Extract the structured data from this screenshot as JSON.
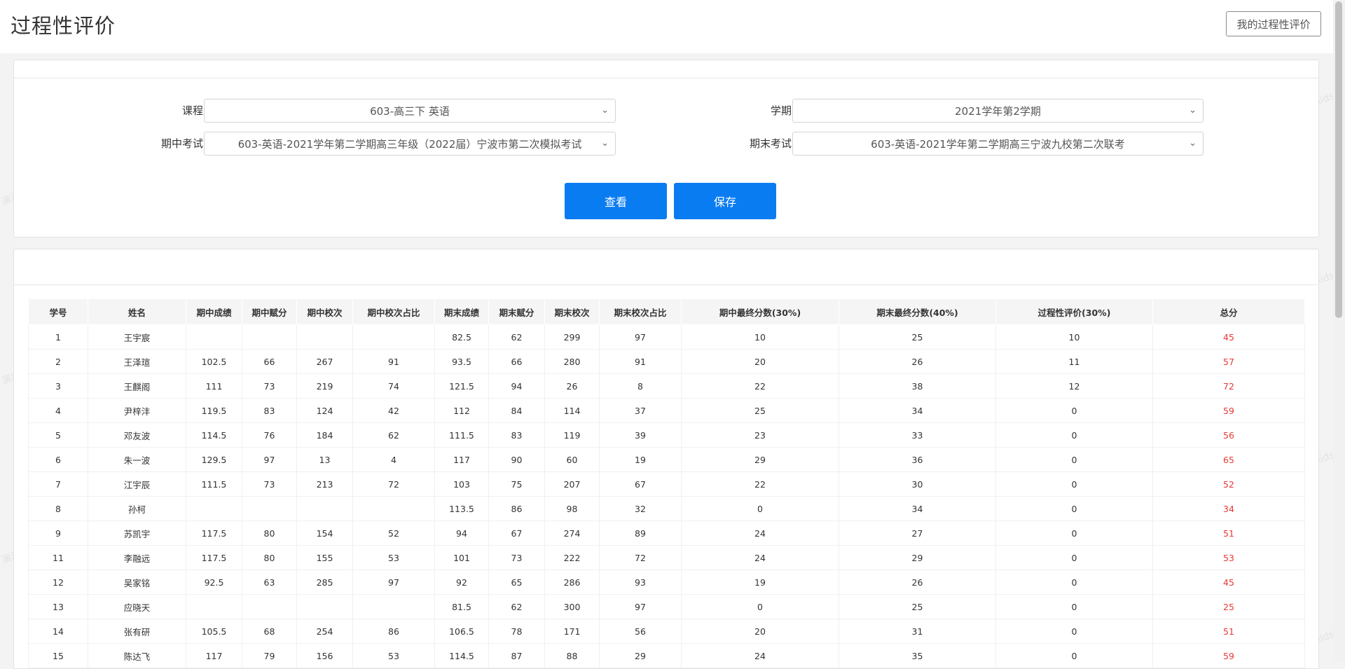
{
  "header": {
    "title": "过程性评价",
    "my_eval_button": "我的过程性评价"
  },
  "filters": {
    "course_label": "课程",
    "course_value": "603-高三下 英语",
    "term_label": "学期",
    "term_value": "2021学年第2学期",
    "midterm_label": "期中考试",
    "midterm_value": "603-英语-2021学年第二学期高三年级（2022届）宁波市第二次模拟考试",
    "final_label": "期末考试",
    "final_value": "603-英语-2021学年第二学期高三宁波九校第二次联考",
    "view_button": "查看",
    "save_button": "保存"
  },
  "watermark": "演示：lids",
  "table": {
    "headers": [
      "学号",
      "姓名",
      "期中成绩",
      "期中赋分",
      "期中校次",
      "期中校次占比",
      "期末成绩",
      "期末赋分",
      "期末校次",
      "期末校次占比",
      "期中最终分数(30%)",
      "期末最终分数(40%)",
      "过程性评价(30%)",
      "总分"
    ],
    "rows": [
      [
        "1",
        "王宇宸",
        "",
        "",
        "",
        "",
        "82.5",
        "62",
        "299",
        "97",
        "10",
        "25",
        "10",
        "45"
      ],
      [
        "2",
        "王泽瑄",
        "102.5",
        "66",
        "267",
        "91",
        "93.5",
        "66",
        "280",
        "91",
        "20",
        "26",
        "11",
        "57"
      ],
      [
        "3",
        "王麒阁",
        "111",
        "73",
        "219",
        "74",
        "121.5",
        "94",
        "26",
        "8",
        "22",
        "38",
        "12",
        "72"
      ],
      [
        "4",
        "尹梓沣",
        "119.5",
        "83",
        "124",
        "42",
        "112",
        "84",
        "114",
        "37",
        "25",
        "34",
        "0",
        "59"
      ],
      [
        "5",
        "邓友波",
        "114.5",
        "76",
        "184",
        "62",
        "111.5",
        "83",
        "119",
        "39",
        "23",
        "33",
        "0",
        "56"
      ],
      [
        "6",
        "朱一波",
        "129.5",
        "97",
        "13",
        "4",
        "117",
        "90",
        "60",
        "19",
        "29",
        "36",
        "0",
        "65"
      ],
      [
        "7",
        "江宇辰",
        "111.5",
        "73",
        "213",
        "72",
        "103",
        "75",
        "207",
        "67",
        "22",
        "30",
        "0",
        "52"
      ],
      [
        "8",
        "孙柯",
        "",
        "",
        "",
        "",
        "113.5",
        "86",
        "98",
        "32",
        "0",
        "34",
        "0",
        "34"
      ],
      [
        "9",
        "苏凯宇",
        "117.5",
        "80",
        "154",
        "52",
        "94",
        "67",
        "274",
        "89",
        "24",
        "27",
        "0",
        "51"
      ],
      [
        "11",
        "李融远",
        "117.5",
        "80",
        "155",
        "53",
        "101",
        "73",
        "222",
        "72",
        "24",
        "29",
        "0",
        "53"
      ],
      [
        "12",
        "吴家铭",
        "92.5",
        "63",
        "285",
        "97",
        "92",
        "65",
        "286",
        "93",
        "19",
        "26",
        "0",
        "45"
      ],
      [
        "13",
        "应晓天",
        "",
        "",
        "",
        "",
        "81.5",
        "62",
        "300",
        "97",
        "0",
        "25",
        "0",
        "25"
      ],
      [
        "14",
        "张有研",
        "105.5",
        "68",
        "254",
        "86",
        "106.5",
        "78",
        "171",
        "56",
        "20",
        "31",
        "0",
        "51"
      ],
      [
        "15",
        "陈达飞",
        "117",
        "79",
        "156",
        "53",
        "114.5",
        "87",
        "88",
        "29",
        "24",
        "35",
        "0",
        "59"
      ]
    ]
  }
}
